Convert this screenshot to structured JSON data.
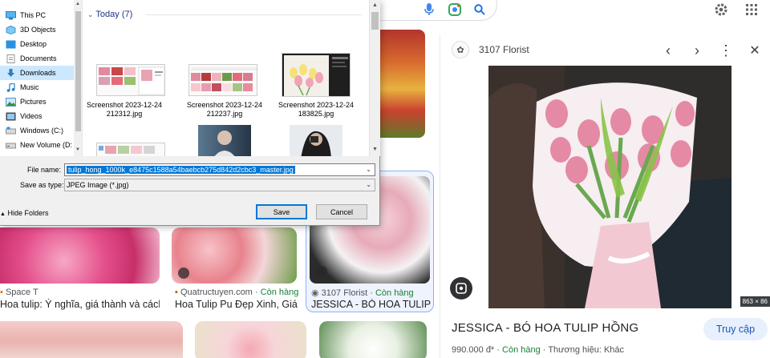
{
  "dialog": {
    "nav_items": [
      {
        "label": "This PC",
        "icon": "pc-icon"
      },
      {
        "label": "3D Objects",
        "icon": "cube-icon"
      },
      {
        "label": "Desktop",
        "icon": "desktop-icon"
      },
      {
        "label": "Documents",
        "icon": "documents-icon"
      },
      {
        "label": "Downloads",
        "icon": "download-icon",
        "selected": true
      },
      {
        "label": "Music",
        "icon": "music-icon"
      },
      {
        "label": "Pictures",
        "icon": "pictures-icon"
      },
      {
        "label": "Videos",
        "icon": "videos-icon"
      },
      {
        "label": "Windows (C:)",
        "icon": "drive-icon"
      },
      {
        "label": "New Volume (D:",
        "icon": "drive-icon"
      }
    ],
    "group_header": "Today (7)",
    "files": [
      {
        "name": "Screenshot 2023-12-24 212312.jpg"
      },
      {
        "name": "Screenshot 2023-12-24 212237.jpg"
      },
      {
        "name": "Screenshot 2023-12-24 183825.jpg"
      }
    ],
    "file_name_label": "File name:",
    "file_name_value": "tulip_hong_1000k_e8475c1588a54baebcb275d842d2cbc3_master.jpg",
    "save_as_type_label": "Save as type:",
    "save_as_type_value": "JPEG Image (*.jpg)",
    "hide_folders_label": "Hide Folders",
    "save_label": "Save",
    "cancel_label": "Cancel"
  },
  "results": {
    "tiles": [
      {
        "site": "Space T",
        "title": "Hoa tulip: Ý nghĩa, giá thành và cách bố ..."
      },
      {
        "site": "Quatructuyen.com",
        "stock": "Còn hàng",
        "title": "Hoa Tulip Pu Đẹp Xinh, Giá ch..."
      },
      {
        "site": "3107 Florist",
        "stock": "Còn hàng",
        "title": "JESSICA - BÓ HOA TULIP – ..."
      }
    ],
    "separator": "·"
  },
  "panel": {
    "site": "3107 Florist",
    "resolution": "863 × 86",
    "title": "JESSICA - BÓ HOA TULIP HỒNG",
    "visit_label": "Truy cập",
    "price": "990.000 đ*",
    "stock": "Còn hàng",
    "brand": "Thương hiệu: Khác"
  },
  "colors": {
    "accent": "#0078d7",
    "google_blue": "#1a73e8",
    "instock_green": "#188038"
  }
}
